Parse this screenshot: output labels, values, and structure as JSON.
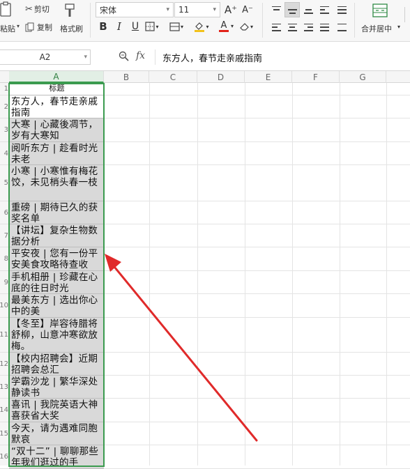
{
  "ribbon": {
    "clipboard": {
      "cut": "剪切",
      "paste": "粘贴",
      "copy": "复制",
      "format_painter": "格式刷"
    },
    "font": {
      "name": "宋体",
      "size": "11",
      "grow": "A⁺",
      "shrink": "A⁻",
      "bold": "B",
      "italic": "I",
      "underline": "U",
      "font_color_letter": "A",
      "fill_color": "#f2c21b",
      "font_color": "#e2231a"
    },
    "alignment": {
      "merge_center": "合并居中"
    }
  },
  "formula_bar": {
    "cell_ref": "A2",
    "fx": "fx",
    "content": "东方人，春节走亲戚指南"
  },
  "columns": [
    "A",
    "B",
    "C",
    "D",
    "E",
    "F",
    "G"
  ],
  "rows": [
    {
      "num": "1",
      "text": "标题"
    },
    {
      "num": "2",
      "text": "东方人，春节走亲戚指南"
    },
    {
      "num": "3",
      "text": "大寒 | 心藏後凋节，岁有大寒知"
    },
    {
      "num": "4",
      "text": "阅听东方 | 趁看时光未老"
    },
    {
      "num": "5",
      "text": "小寒 | 小寒惟有梅花饺，未见梢头春一枝"
    },
    {
      "num": "6",
      "text": "重磅 | 期待已久的获奖名单"
    },
    {
      "num": "7",
      "text": "【讲坛】复杂生物数据分析"
    },
    {
      "num": "8",
      "text": "平安夜 | 您有一份平安美食攻略待查收"
    },
    {
      "num": "9",
      "text": "手机相册 | 珍藏在心底的往日时光"
    },
    {
      "num": "10",
      "text": "最美东方 | 选出你心中的美"
    },
    {
      "num": "11",
      "text": "【冬至】岸容待腊将舒柳，山意冲寒欲放梅。"
    },
    {
      "num": "12",
      "text": "【校内招聘会】近期招聘会总汇"
    },
    {
      "num": "13",
      "text": "学霸沙龙 | 繁华深处静读书"
    },
    {
      "num": "14",
      "text": "喜讯 | 我院英语大神喜获省大奖"
    },
    {
      "num": "15",
      "text": "今天，请为遇难同胞默哀"
    },
    {
      "num": "16",
      "text": "“双十二” | 聊聊那些年我们逛过的手"
    }
  ],
  "colors": {
    "selection": "#3b9b4f",
    "arrow": "#e02a2a",
    "cell_fill": "#d9d9d9"
  }
}
